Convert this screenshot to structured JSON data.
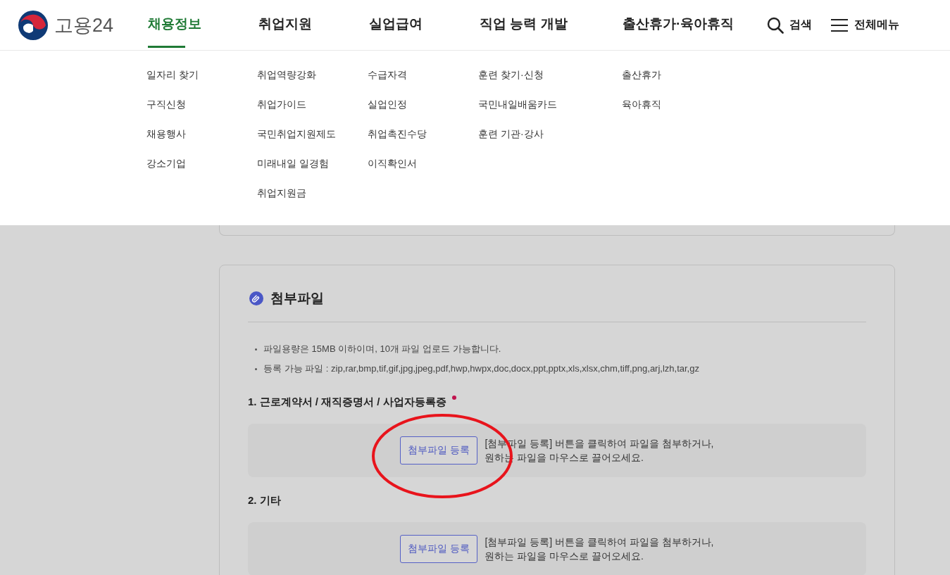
{
  "header": {
    "logo_text": "고용24",
    "nav": [
      {
        "label": "채용정보",
        "selected": true,
        "links": [
          "일자리 찾기",
          "구직신청",
          "채용행사",
          "강소기업"
        ]
      },
      {
        "label": "취업지원",
        "selected": false,
        "links": [
          "취업역량강화",
          "취업가이드",
          "국민취업지원제도",
          "미래내일 일경험",
          "취업지원금"
        ]
      },
      {
        "label": "실업급여",
        "selected": false,
        "links": [
          "수급자격",
          "실업인정",
          "취업촉진수당",
          "이직확인서"
        ]
      },
      {
        "label": "직업 능력 개발",
        "selected": false,
        "links": [
          "훈련 찾기·신청",
          "국민내일배움카드",
          "훈련 기관·강사"
        ]
      },
      {
        "label": "출산휴가·육아휴직",
        "selected": false,
        "links": [
          "출산휴가",
          "육아휴직"
        ]
      }
    ],
    "search": "검색",
    "all_menu": "전체메뉴"
  },
  "attachments": {
    "title": "첨부파일",
    "notes": [
      "파일용량은 15MB 이하이며, 10개 파일 업로드 가능합니다.",
      "등록 가능 파일 : zip,rar,bmp,tif,gif,jpg,jpeg,pdf,hwp,hwpx,doc,docx,ppt,pptx,xls,xlsx,chm,tiff,png,arj,lzh,tar,gz"
    ],
    "sections": [
      {
        "title": "1. 근로계약서 / 재직증명서 / 사업자등록증",
        "required": true,
        "button": "첨부파일 등록",
        "hint_lines": [
          "[첨부파일 등록] 버튼을 클릭하여 파일을 첨부하거나,",
          "원하는 파일을 마우스로 끌어오세요."
        ]
      },
      {
        "title": "2. 기타",
        "required": false,
        "button": "첨부파일 등록",
        "hint_lines": [
          "[첨부파일 등록] 버튼을 클릭하여 파일을 첨부하거나,",
          "원하는 파일을 마우스로 끌어오세요."
        ]
      }
    ]
  }
}
